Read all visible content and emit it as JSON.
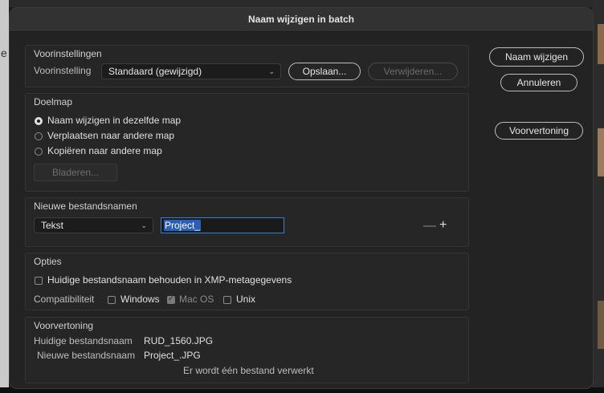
{
  "background": {
    "left_glyph": "e"
  },
  "dialog": {
    "title": "Naam wijzigen in batch",
    "presets": {
      "group_title": "Voorinstellingen",
      "label": "Voorinstelling",
      "selected": "Standaard (gewijzigd)",
      "save": "Opslaan...",
      "delete": "Verwijderen..."
    },
    "destination": {
      "group_title": "Doelmap",
      "options": [
        "Naam wijzigen in dezelfde map",
        "Verplaatsen naar andere map",
        "Kopiëren naar andere map"
      ],
      "selected_index": 0,
      "browse": "Bladeren..."
    },
    "new_names": {
      "group_title": "Nieuwe bestandsnamen",
      "type": "Tekst",
      "value": "Project_",
      "minus": "—",
      "plus": "+"
    },
    "options": {
      "group_title": "Opties",
      "keep_name": "Huidige bestandsnaam behouden in XMP-metagegevens",
      "compat_label": "Compatibiliteit",
      "windows": "Windows",
      "macos": "Mac OS",
      "unix": "Unix"
    },
    "preview": {
      "group_title": "Voorvertoning",
      "current_label": "Huidige bestandsnaam",
      "current_value": "RUD_1560.JPG",
      "new_label": "Nieuwe bestandsnaam",
      "new_value": "Project_.JPG",
      "status": "Er wordt één bestand verwerkt"
    },
    "buttons": {
      "rename": "Naam wijzigen",
      "cancel": "Annuleren",
      "preview": "Voorvertoning"
    }
  }
}
